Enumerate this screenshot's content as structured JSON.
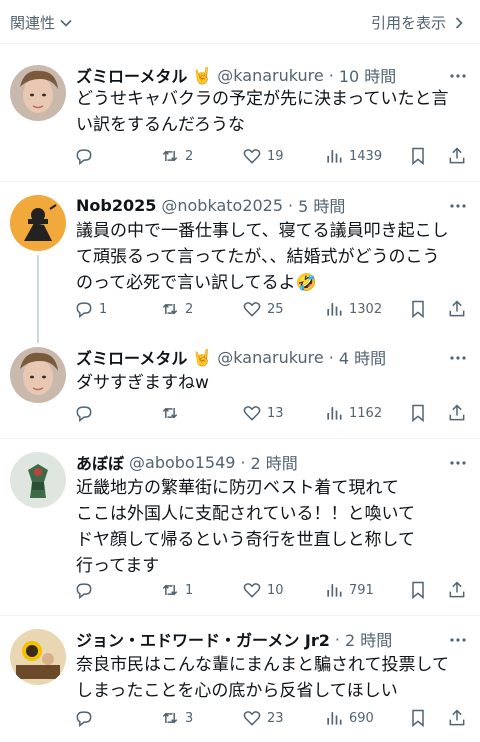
{
  "topbar": {
    "related_label": "関連性",
    "quote_label": "引用を表示"
  },
  "posts": [
    {
      "name": "ズミローメタル",
      "name_emoji": "🤘",
      "handle": "@kanarukure",
      "dot": "·",
      "time": "10 時間",
      "body": "どうせキャバクラの予定が先に決まっていたと言\nい訳をするんだろうな",
      "replies": "",
      "reposts": "2",
      "likes": "19",
      "views": "1439"
    },
    {
      "name": "Nob2025",
      "name_emoji": "",
      "handle": "@nobkato2025",
      "dot": "·",
      "time": "5 時間",
      "body": "議員の中で一番仕事して、寝てる議員叩き起こし\nて頑張るって言ってたが、、結婚式がどうのこう\nのって必死で言い訳してるよ🤣",
      "replies": "1",
      "reposts": "2",
      "likes": "25",
      "views": "1302"
    },
    {
      "name": "ズミローメタル",
      "name_emoji": "🤘",
      "handle": "@kanarukure",
      "dot": "·",
      "time": "4 時間",
      "body": "ダサすぎますねw",
      "replies": "",
      "reposts": "",
      "likes": "13",
      "views": "1162"
    },
    {
      "name": "あぼぼ",
      "name_emoji": "",
      "handle": "@abobo1549",
      "dot": "·",
      "time": "2 時間",
      "body": "近畿地方の繁華街に防刃ベスト着て現れて\nここは外国人に支配されている！！と喚いて\nドヤ顔して帰るという奇行を世直しと称して\n行ってます",
      "replies": "",
      "reposts": "1",
      "likes": "10",
      "views": "791"
    },
    {
      "name": "ジョン・エドワード・ガーメン Jr2",
      "name_emoji": "",
      "handle": "",
      "dot": "·",
      "time": "2 時間",
      "body": "奈良市民はこんな輩にまんまと騙されて投票して\nしまったことを心の底から反省してほしい",
      "replies": "",
      "reposts": "3",
      "likes": "23",
      "views": "690"
    }
  ],
  "icons": {
    "reply": "reply-icon",
    "repost": "repost-icon",
    "like": "heart-icon",
    "views": "views-icon",
    "bookmark": "bookmark-icon",
    "share": "share-icon",
    "more": "more-icon"
  },
  "colors": {
    "text": "#0f1419",
    "secondary": "#536471",
    "divider": "#eff3f4"
  }
}
